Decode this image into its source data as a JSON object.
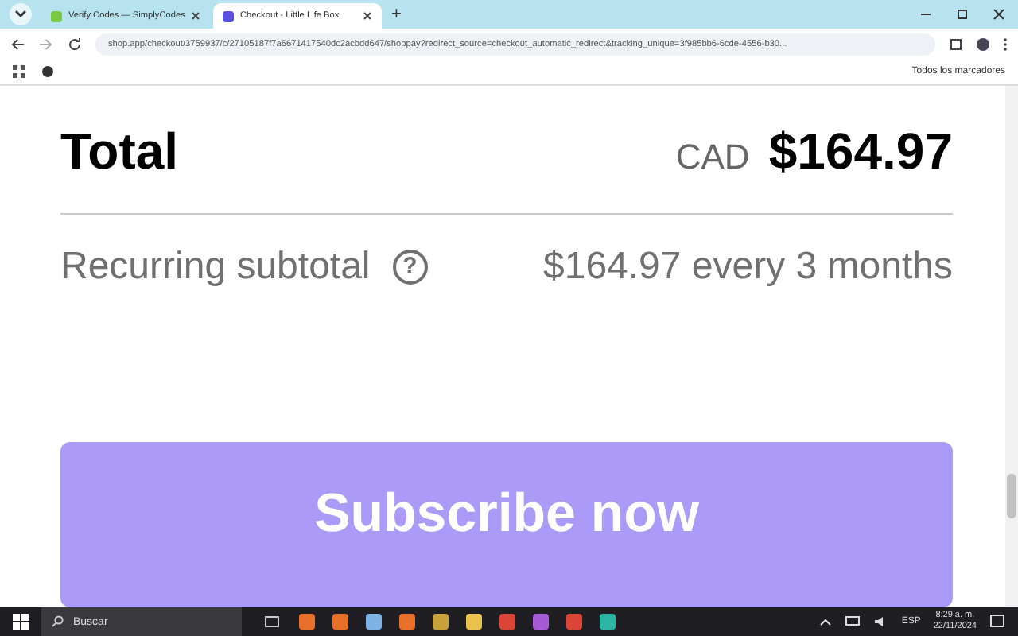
{
  "tabs": [
    {
      "label": "Verify Codes — SimplyCodes",
      "selected": false
    },
    {
      "label": "Checkout - Little Life Box",
      "selected": true
    }
  ],
  "new_tab": "+",
  "address": "shop.app/checkout/3759937/c/27105187f7a6671417540dc2acbdd647/shoppay?redirect_source=checkout_automatic_redirect&tracking_unique=3f985bb6-6cde-4556-b30...",
  "bookmarks_folder": "Todos los marcadores",
  "total": {
    "label": "Total",
    "currency": "CAD",
    "amount": "$164.97"
  },
  "recurring": {
    "label": "Recurring subtotal",
    "help": "?",
    "value": "$164.97 every 3 months"
  },
  "subscribe_button": "Subscribe now",
  "taskbar": {
    "search": "Buscar",
    "lang": "ESP",
    "time": "8:29 a. m.",
    "date": "22/11/2024"
  }
}
